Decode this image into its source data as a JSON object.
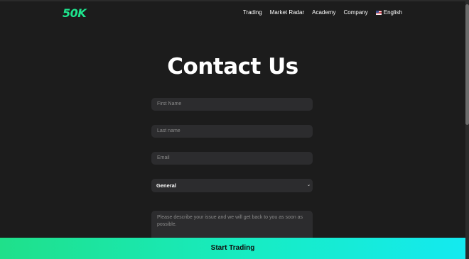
{
  "header": {
    "logo_text": "50K",
    "nav": [
      {
        "label": "Trading"
      },
      {
        "label": "Market Radar"
      },
      {
        "label": "Academy"
      },
      {
        "label": "Company"
      }
    ],
    "language": {
      "label": "English",
      "flag_icon": "us-flag-icon"
    }
  },
  "main": {
    "title": "Contact Us",
    "form": {
      "first_name_placeholder": "First Name",
      "last_name_placeholder": "Last name",
      "email_placeholder": "Email",
      "topic_selected": "General",
      "message_placeholder": "Please describe your issue and we will get back to you as soon as possible."
    }
  },
  "footer_cta": {
    "label": "Start Trading"
  },
  "colors": {
    "background": "#1c1c1c",
    "field_background": "#2c2c2e",
    "brand_green": "#1ee58e",
    "cta_gradient_start": "#1fe08a",
    "cta_gradient_end": "#14eaf0"
  }
}
